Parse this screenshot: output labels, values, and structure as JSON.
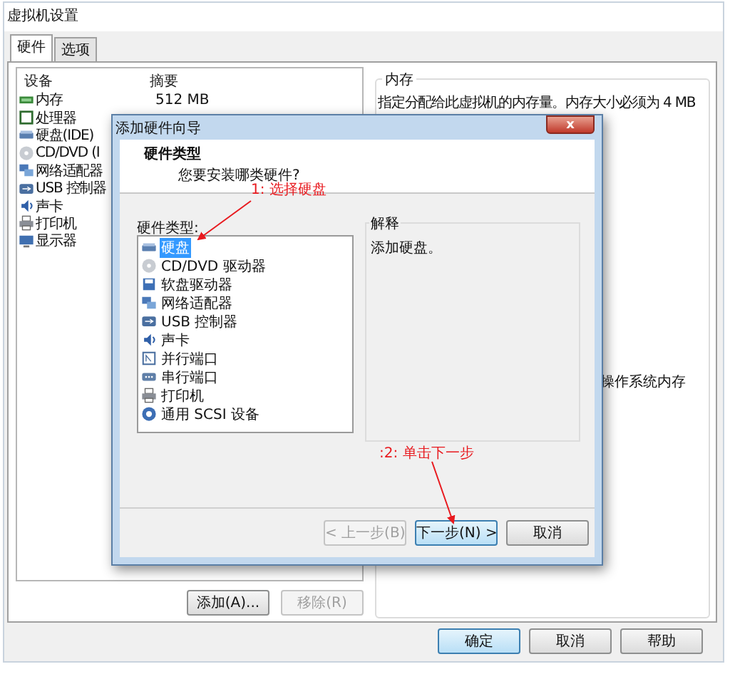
{
  "window": {
    "title": "虚拟机设置"
  },
  "tabs": [
    {
      "label": "硬件",
      "selected": true
    },
    {
      "label": "选项",
      "selected": false
    }
  ],
  "device_table": {
    "columns": [
      "设备",
      "摘要"
    ],
    "rows": [
      {
        "kind": "memory",
        "device": "内存",
        "summary": "512 MB"
      },
      {
        "kind": "cpu",
        "device": "处理器"
      },
      {
        "kind": "disk",
        "device": "硬盘(IDE)"
      },
      {
        "kind": "cdrom",
        "device": "CD/DVD (I"
      },
      {
        "kind": "network",
        "device": "网络适配器"
      },
      {
        "kind": "usb",
        "device": "USB 控制器"
      },
      {
        "kind": "sound",
        "device": "声卡"
      },
      {
        "kind": "printer",
        "device": "打印机"
      },
      {
        "kind": "display",
        "device": "显示器"
      }
    ]
  },
  "memory_group": {
    "title": "内存",
    "description": "指定分配给此虚拟机的内存量。内存大小必须为 4 MB",
    "note": "操作系统内存"
  },
  "device_buttons": [
    {
      "label": "添加(A)...",
      "disabled": false
    },
    {
      "label": "移除(R)",
      "disabled": true
    }
  ],
  "dialog_buttons": [
    {
      "label": "确定",
      "default": true
    },
    {
      "label": "取消",
      "default": false
    },
    {
      "label": "帮助",
      "default": false
    }
  ],
  "wizard": {
    "title": "添加硬件向导",
    "close": "x",
    "heading": "硬件类型",
    "subheading": "您要安装哪类硬件?",
    "list_label": "硬件类型:",
    "hardware_types": [
      {
        "kind": "disk",
        "label": "硬盘",
        "selected": true
      },
      {
        "kind": "cdrom",
        "label": "CD/DVD 驱动器",
        "selected": false
      },
      {
        "kind": "floppy",
        "label": "软盘驱动器",
        "selected": false
      },
      {
        "kind": "network",
        "label": "网络适配器",
        "selected": false
      },
      {
        "kind": "usb",
        "label": "USB 控制器",
        "selected": false
      },
      {
        "kind": "sound",
        "label": "声卡",
        "selected": false
      },
      {
        "kind": "parallel",
        "label": "并行端口",
        "selected": false
      },
      {
        "kind": "serial",
        "label": "串行端口",
        "selected": false
      },
      {
        "kind": "printer",
        "label": "打印机",
        "selected": false
      },
      {
        "kind": "scsi",
        "label": "通用 SCSI 设备",
        "selected": false
      }
    ],
    "explanation_title": "解释",
    "explanation": "添加硬盘。",
    "buttons": [
      {
        "label": "< 上一步(B)",
        "disabled": true,
        "default": false
      },
      {
        "label": "下一步(N) >",
        "disabled": false,
        "default": true
      },
      {
        "label": "取消",
        "disabled": false,
        "default": false
      }
    ]
  },
  "annotations": [
    {
      "text": "1: 选择硬盘"
    },
    {
      "text": ":2: 单击下一步"
    }
  ]
}
